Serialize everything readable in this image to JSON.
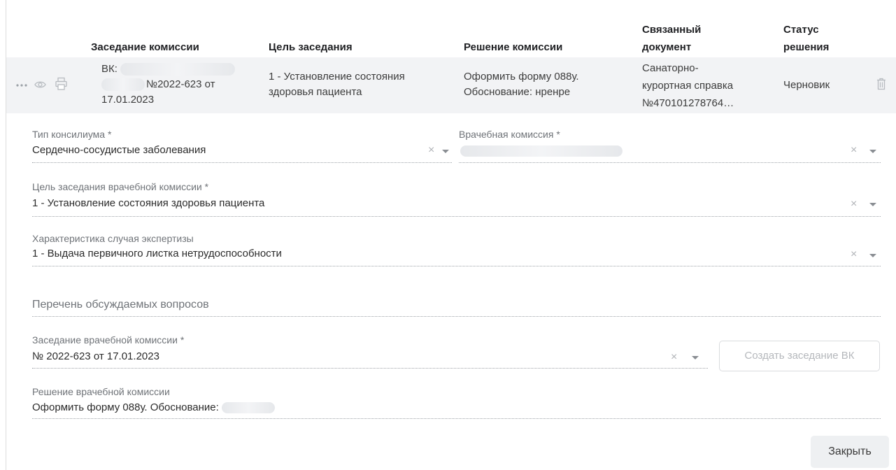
{
  "table": {
    "headers": {
      "session": "Заседание комиссии",
      "goal": "Цель заседания",
      "decision": "Решение комиссии",
      "linked_doc_l1": "Связанный",
      "linked_doc_l2": "документ",
      "status_l1": "Статус",
      "status_l2": "решения"
    },
    "row": {
      "session_prefix": "ВК:",
      "session_number": "№2022-623 от",
      "session_date": "17.01.2023",
      "goal_l1": "1 - Установление состояния",
      "goal_l2": "здоровья пациента",
      "decision_l1": "Оформить форму 088у.",
      "decision_l2": "Обоснование: нренре",
      "doc_l1": "Санаторно-",
      "doc_l2": "курортная справка",
      "doc_l3": "№470101278764…",
      "status": "Черновик",
      "icons": [
        "more-icon",
        "eye-icon",
        "print-icon",
        "trash-icon"
      ]
    }
  },
  "form": {
    "consilium_type": {
      "label": "Тип консилиума *",
      "value": "Сердечно-сосудистые заболевания"
    },
    "commission": {
      "label": "Врачебная комиссия *"
    },
    "session_goal": {
      "label": "Цель заседания врачебной комиссии *",
      "value": "1 - Установление состояния здоровья пациента"
    },
    "expertise": {
      "label": "Характеристика случая экспертизы",
      "value": "1 - Выдача первичного листка нетрудоспособности"
    },
    "questions": {
      "placeholder": "Перечень обсуждаемых вопросов"
    },
    "session": {
      "label": "Заседание врачебной комиссии *",
      "value": "№ 2022-623 от 17.01.2023"
    },
    "decision": {
      "label": "Решение врачебной комиссии",
      "value": "Оформить форму 088у. Обоснование:"
    }
  },
  "buttons": {
    "create_session": "Создать заседание ВК",
    "close": "Закрыть"
  },
  "colors": {
    "row_bg": "#f2f3f5",
    "muted_text": "#6f7378",
    "disabled_text": "#b5b8bc"
  }
}
